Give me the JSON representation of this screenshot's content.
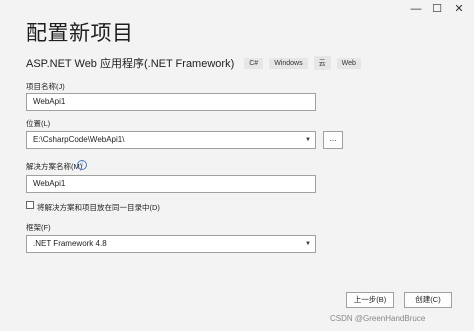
{
  "window": {
    "minimize": "—",
    "maximize": "☐",
    "close": "✕"
  },
  "page_title": "配置新项目",
  "template": {
    "name": "ASP.NET Web 应用程序(.NET Framework)",
    "tags": [
      "C#",
      "Windows",
      "云",
      "Web"
    ]
  },
  "project_name": {
    "label": "项目名称(J)",
    "value": "WebApi1"
  },
  "location": {
    "label": "位置(L)",
    "value": "E:\\CsharpCode\\WebApi1\\",
    "browse": "..."
  },
  "solution_name": {
    "label": "解决方案名称(M)",
    "value": "WebApi1",
    "info": "i"
  },
  "same_dir": {
    "label": "将解决方案和项目放在同一目录中(D)",
    "checked": false
  },
  "framework": {
    "label": "框架(F)",
    "value": ".NET Framework 4.8"
  },
  "buttons": {
    "back": "上一步(B)",
    "create": "创建(C)"
  },
  "watermark": "CSDN @GreenHandBruce"
}
